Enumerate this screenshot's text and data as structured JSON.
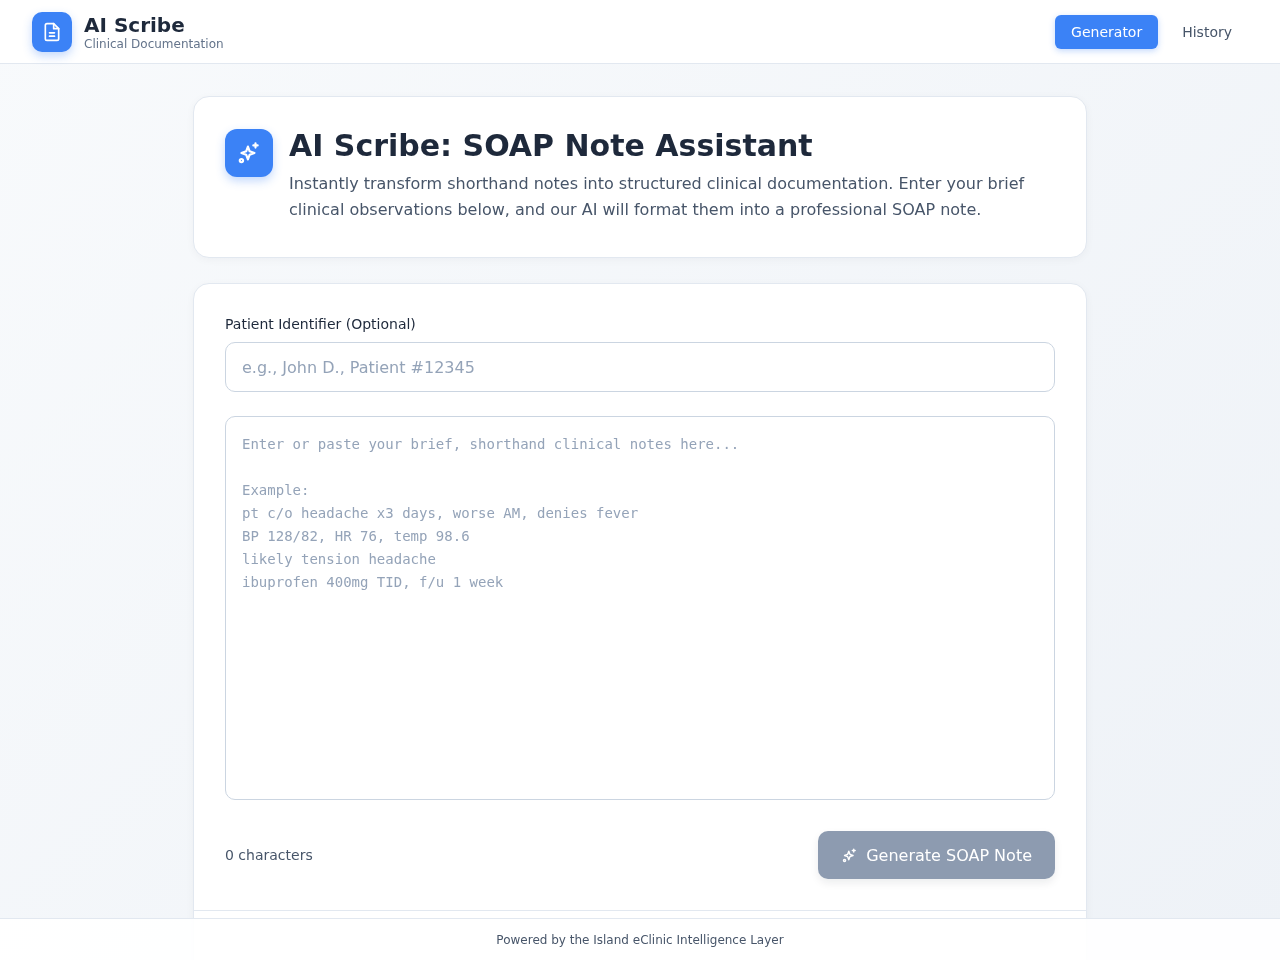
{
  "header": {
    "app_name": "AI Scribe",
    "subtitle": "Clinical Documentation",
    "nav": [
      {
        "label": "Generator",
        "selected": true
      },
      {
        "label": "History",
        "selected": false
      }
    ]
  },
  "intro": {
    "title": "AI Scribe: SOAP Note Assistant",
    "description": "Instantly transform shorthand notes into structured clinical documentation. Enter your brief clinical observations below, and our AI will format them into a professional SOAP note."
  },
  "form": {
    "patient_label": "Patient Identifier (Optional)",
    "patient_placeholder": "e.g., John D., Patient #12345",
    "notes_placeholder": "Enter or paste your brief, shorthand clinical notes here...\n\nExample:\npt c/o headache x3 days, worse AM, denies fever\nBP 128/82, HR 76, temp 98.6\nlikely tension headache\nibuprofen 400mg TID, f/u 1 week",
    "char_count": "0 characters",
    "generate_button": {
      "label": "Generate SOAP Note",
      "disabled": true
    }
  },
  "footer": {
    "text": "Powered by the Island eClinic Intelligence Layer"
  }
}
